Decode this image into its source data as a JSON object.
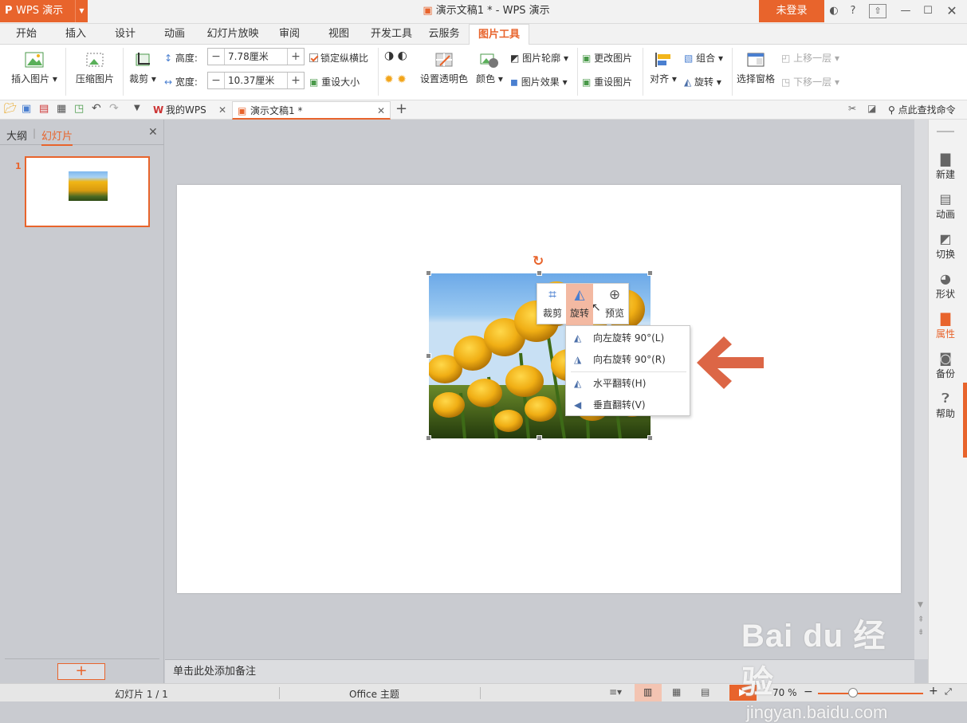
{
  "app": {
    "name": "WPS 演示",
    "doc_title": "演示文稿1 * - WPS 演示",
    "login": "未登录"
  },
  "tabs": [
    "开始",
    "插入",
    "设计",
    "动画",
    "幻灯片放映",
    "审阅",
    "视图",
    "开发工具",
    "云服务",
    "图片工具"
  ],
  "ribbon": {
    "insert_pic": "插入图片",
    "compress": "压缩图片",
    "crop": "裁剪",
    "height_label": "高度:",
    "height_value": "7.78厘米",
    "width_label": "宽度:",
    "width_value": "10.37厘米",
    "lock_ratio": "锁定纵横比",
    "reset_size": "重设大小",
    "set_transparent": "设置透明色",
    "color": "颜色",
    "pic_outline": "图片轮廓",
    "pic_effect": "图片效果",
    "change_pic": "更改图片",
    "reset_pic": "重设图片",
    "align": "对齐",
    "group": "组合",
    "rotate": "旋转",
    "select_pane": "选择窗格",
    "bring_forward": "上移一层",
    "send_backward": "下移一层"
  },
  "docbar": {
    "tab1": "我的WPS",
    "tab2": "演示文稿1 *",
    "search": "点此查找命令"
  },
  "leftpanel": {
    "outline": "大纲",
    "slides": "幻灯片",
    "slide_number": "1",
    "add": "+"
  },
  "minibar": {
    "crop": "裁剪",
    "rotate": "旋转",
    "preview": "预览"
  },
  "menu": {
    "rot_left": "向左旋转 90°(L)",
    "rot_right": "向右旋转 90°(R)",
    "flip_h": "水平翻转(H)",
    "flip_v": "垂直翻转(V)"
  },
  "notes": "单击此处添加备注",
  "rightbar": [
    "新建",
    "动画",
    "切换",
    "形状",
    "属性",
    "备份",
    "帮助"
  ],
  "status": {
    "slide": "幻灯片 1 / 1",
    "theme": "Office 主题",
    "zoom": "70 %"
  },
  "watermark": {
    "brand": "Bai du 经验",
    "url": "jingyan.baidu.com"
  },
  "colors": {
    "accent": "#e8642c",
    "arrow": "#dc6646"
  }
}
